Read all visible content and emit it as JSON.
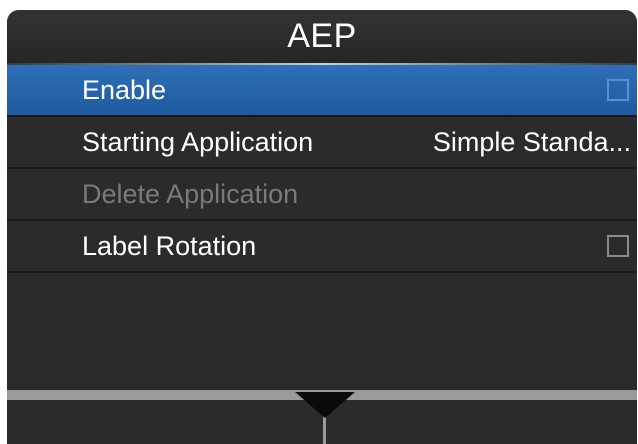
{
  "header": {
    "title": "AEP"
  },
  "menu": {
    "items": [
      {
        "label": "Enable",
        "value": "",
        "control": "checkbox",
        "checked": false,
        "selected": true,
        "enabled": true
      },
      {
        "label": "Starting Application",
        "value": "Simple Standa...",
        "control": "value",
        "selected": false,
        "enabled": true
      },
      {
        "label": "Delete Application",
        "value": "",
        "control": "none",
        "selected": false,
        "enabled": false
      },
      {
        "label": "Label Rotation",
        "value": "",
        "control": "checkbox",
        "checked": false,
        "selected": false,
        "enabled": true
      }
    ]
  },
  "softkeys": {
    "center_icon": "down-arrow-icon"
  },
  "colors": {
    "selected_row": "#2e6fb5",
    "background": "#2b2b2b",
    "disabled_text": "#7a7a7a"
  }
}
